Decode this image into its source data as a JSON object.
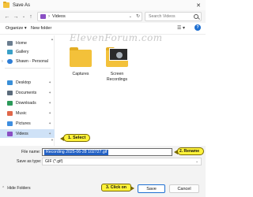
{
  "window": {
    "title": "Save As",
    "close_glyph": "✕"
  },
  "address_bar": {
    "crumb": "Videos",
    "separator": "›",
    "search_placeholder": "Search Videos"
  },
  "nav": {
    "back": "←",
    "forward": "→",
    "dropdown": "⌄",
    "up": "↑"
  },
  "toolbar": {
    "organize": "Organize ▾",
    "new_folder": "New folder",
    "view": "☰ ▾",
    "help": "?"
  },
  "watermark": "ElevenForum.com",
  "sidebar": {
    "items": [
      {
        "label": "Home",
        "icon": "home-icon",
        "color": "#6a7d8f"
      },
      {
        "label": "Gallery",
        "icon": "gallery-icon",
        "color": "#3aa0c8"
      },
      {
        "label": "Shawn - Personal",
        "icon": "onedrive-icon",
        "color": "#2f7fd6",
        "chevron": "›"
      },
      {
        "label": "Desktop",
        "icon": "desktop-icon",
        "color": "#3a8fd8",
        "pin": "✦"
      },
      {
        "label": "Documents",
        "icon": "documents-icon",
        "color": "#5b6b7b",
        "pin": "✦"
      },
      {
        "label": "Downloads",
        "icon": "downloads-icon",
        "color": "#2c9a5a",
        "pin": "✦"
      },
      {
        "label": "Music",
        "icon": "music-icon",
        "color": "#e0674a",
        "pin": "✦"
      },
      {
        "label": "Pictures",
        "icon": "pictures-icon",
        "color": "#3e8ee0",
        "pin": "✦"
      },
      {
        "label": "Videos",
        "icon": "videos-icon",
        "color": "#8a4fc4",
        "pin": "✦"
      }
    ]
  },
  "folders": [
    {
      "label": "Captures"
    },
    {
      "label": "Screen Recordings"
    }
  ],
  "form": {
    "file_name_label": "File name:",
    "file_name_value": "Recording 2025-06-28 102727.gif",
    "save_as_type_label": "Save as type:",
    "save_as_type_value": "GIF (*.gif)",
    "dropdown": "⌄"
  },
  "footer": {
    "hide_folders": "Hide Folders",
    "caret": "⌃",
    "save": "Save",
    "cancel": "Cancel"
  },
  "callouts": {
    "select": "1. Select",
    "rename": "2. Rename",
    "click": "3. Click on"
  }
}
